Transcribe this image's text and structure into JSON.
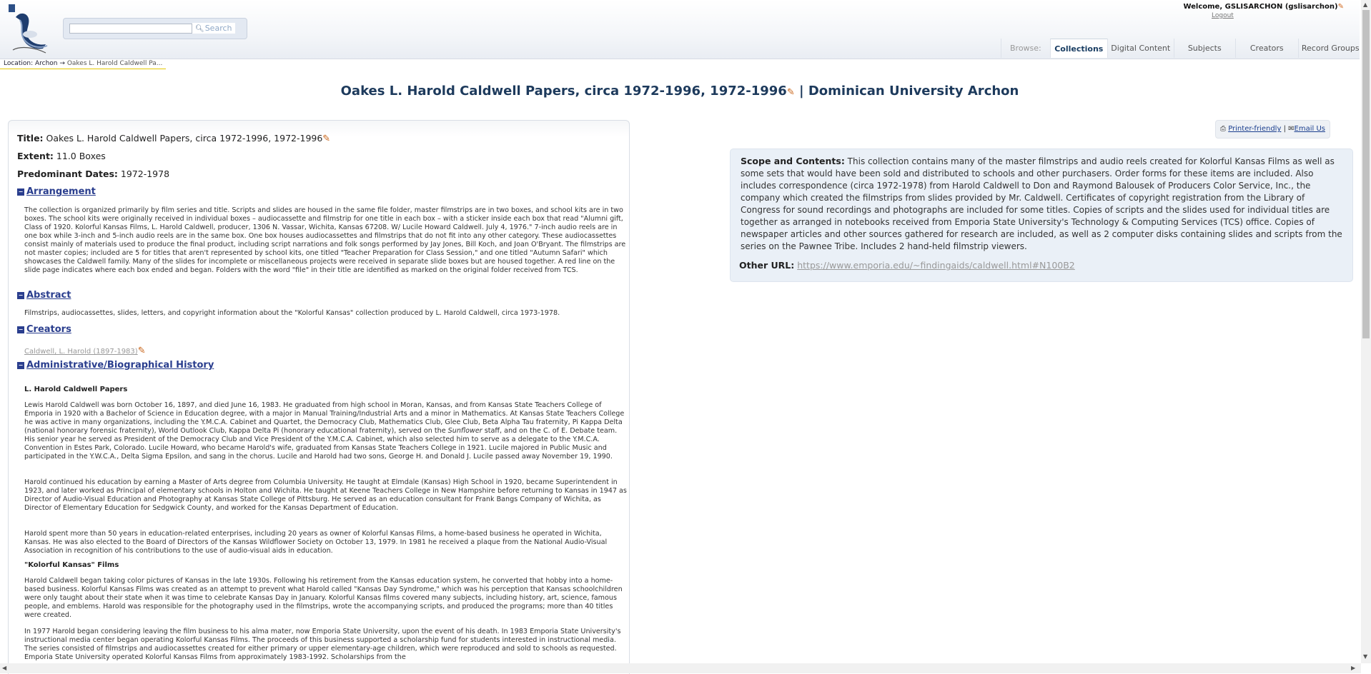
{
  "header": {
    "search": {
      "placeholder": "",
      "button_label": "Search"
    },
    "welcome": "Welcome, GSLISARCHON (gslisarchon)",
    "logout": "Logout",
    "nav": {
      "browse_label": "Browse:",
      "tabs": [
        "Collections",
        "Digital Content",
        "Subjects",
        "Creators",
        "Record Groups"
      ],
      "active": "Collections"
    }
  },
  "location": {
    "label": "Location:",
    "root": "Archon",
    "arrow": "→",
    "current": "Oakes L. Harold Caldwell Pa..."
  },
  "title": {
    "main": "Oakes L. Harold Caldwell Papers, circa 1972-1996, 1972-1996",
    "suffix": " | Dominican University Archon"
  },
  "fields": {
    "title_label": "Title:",
    "title_value": "Oakes L. Harold Caldwell Papers, circa 1972-1996, 1972-1996",
    "extent_label": "Extent:",
    "extent_value": "11.0 Boxes",
    "dates_label": "Predominant Dates:",
    "dates_value": "1972-1978"
  },
  "sections": {
    "arrangement": {
      "heading": "Arrangement",
      "text": "The collection is organized primarily by film series and title. Scripts and slides are housed in the same file folder, master filmstrips are in two boxes, and school kits are in two boxes. The school kits were originally received in individual boxes – audiocassette and filmstrip for one title in each box – with a sticker inside each box that read \"Alumni gift, Class of 1920. Kolorful Kansas Films, L. Harold Caldwell, producer, 1306 N. Vassar, Wichita, Kansas 67208. W/ Lucile Howard Caldwell. July 4, 1976.\" 7-inch audio reels are in one box while 3-inch and 5-inch audio reels are in the same box. One box houses audiocassettes and filmstrips that do not fit into any other category. These audiocassettes consist mainly of materials used to produce the final product, including script narrations and folk songs performed by Jay Jones, Bill Koch, and Joan O'Bryant. The filmstrips are not master copies; included are 5 for titles that aren't represented by school kits, one titled \"Teacher Preparation for Class Session,\" and one titled \"Autumn Safari\" which showcases the Caldwell family. Many of the slides for incomplete or miscellaneous projects were received in separate slide boxes but are housed together. A red line on the slide page indicates where each box ended and began. Folders with the word \"file\" in their title are identified as marked on the original folder received from TCS."
    },
    "abstract": {
      "heading": "Abstract",
      "text": "Filmstrips, audiocassettes, slides, letters, and copyright information about the \"Kolorful Kansas\" collection produced by L. Harold Caldwell, circa 1973-1978."
    },
    "creators": {
      "heading": "Creators",
      "link": "Caldwell, L. Harold (1897-1983)"
    },
    "history": {
      "heading": "Administrative/Biographical History",
      "sub1": "L. Harold Caldwell Papers",
      "p1a": "Lewis Harold Caldwell was born October 16, 1897, and died June 16, 1983. He graduated from high school in Moran, Kansas, and from Kansas State Teachers College of Emporia in 1920 with a Bachelor of Science in Education degree, with a major in Manual Training/Industrial Arts and a minor in Mathematics. At Kansas State Teachers College he was active in many organizations, including the Y.M.C.A. Cabinet and Quartet, the Democracy Club, Mathematics Club, Glee Club, Beta Alpha Tau fraternity, Pi Kappa Delta (national honorary forensic fraternity), World Outlook Club, Kappa Delta Pi (honorary educational fraternity), served on the ",
      "p1i": "Sunflower",
      "p1b": " staff, and on the C. of E. Debate team. His senior year he served as President of the Democracy Club and Vice President of the Y.M.C.A. Cabinet, which also selected him to serve as a delegate to the Y.M.C.A. Convention in Estes Park, Colorado. Lucile Howard, who became Harold's wife, graduated from Kansas State Teachers College in 1921. Lucile majored in Public Music and participated in the Y.W.C.A., Delta Sigma Epsilon, and sang in the chorus. Lucile and Harold had two sons, George H. and Donald J. Lucile passed away November 19, 1990.",
      "p2": "Harold continued his education by earning a Master of Arts degree from Columbia University. He taught at Elmdale (Kansas) High School in 1920, became Superintendent in 1923, and later worked as Principal of elementary schools in Holton and Wichita. He taught at Keene Teachers College in New Hampshire before returning to Kansas in 1947 as Director of Audio-Visual Education and Photography at Kansas State College of Pittsburg. He served as an education consultant for Frank Bangs Company of Wichita, as Director of Elementary Education for Sedgwick County, and worked for the Kansas Department of Education.",
      "p3": "Harold spent more than 50 years in education-related enterprises, including 20 years as owner of Kolorful Kansas Films, a home-based business he operated in Wichita, Kansas. He was also elected to the Board of Directors of the Kansas Wildflower Society on October 13, 1979. In 1981 he received a plaque from the National Audio-Visual Association in recognition of his contributions to the use of audio-visual aids in education.",
      "sub2": "\"Kolorful Kansas\" Films",
      "p4": "Harold Caldwell began taking color pictures of Kansas in the late 1930s. Following his retirement from the Kansas education system, he converted that hobby into a home-based business. Kolorful Kansas Films was created as an attempt to prevent what Harold called \"Kansas Day Syndrome,\" which was his perception that Kansas schoolchildren were only taught about their state when it was time to celebrate Kansas Day in January. Kolorful Kansas films covered many subjects, including history, art, science, famous people, and emblems. Harold was responsible for the photography used in the filmstrips, wrote the accompanying scripts, and produced the programs; more than 40 titles were created.",
      "p5": "In 1977 Harold began considering leaving the film business to his alma mater, now Emporia State University, upon the event of his death. In 1983 Emporia State University's instructional media center began operating Kolorful Kansas Films. The proceeds of this business supported a scholarship fund for students interested in instructional media. The series consisted of filmstrips and audiocassettes created for either primary or upper elementary-age children, which were reproduced and sold to schools as requested. Emporia State University operated Kolorful Kansas Films from approximately 1983-1992. Scholarships from the"
    }
  },
  "tools": {
    "printer": "Printer-friendly",
    "sep": "|",
    "email": "Email Us"
  },
  "scope": {
    "label": "Scope and Contents:",
    "text": "This collection contains many of the master filmstrips and audio reels created for Kolorful Kansas Films as well as some sets that would have been sold and distributed to schools and other purchasers. Order forms for these items are included. Also includes correspondence (circa 1972-1978) from Harold Caldwell to Don and Raymond Balousek of Producers Color Service, Inc., the company which created the filmstrips from slides provided by Mr. Caldwell. Certificates of copyright registration from the Library of Congress for sound recordings and photographs are included for some titles. Copies of scripts and the slides used for individual titles are together as arranged in notebooks received from Emporia State University's Technology & Computing Services (TCS) office. Copies of newspaper articles and other sources gathered for research are included, as well as 2 computer disks containing slides and scripts from the series on the Pawnee Tribe. Includes 2 hand-held filmstrip viewers.",
    "other_url_label": "Other URL:",
    "other_url": "https://www.emporia.edu/~findingaids/caldwell.html#N100B2"
  }
}
